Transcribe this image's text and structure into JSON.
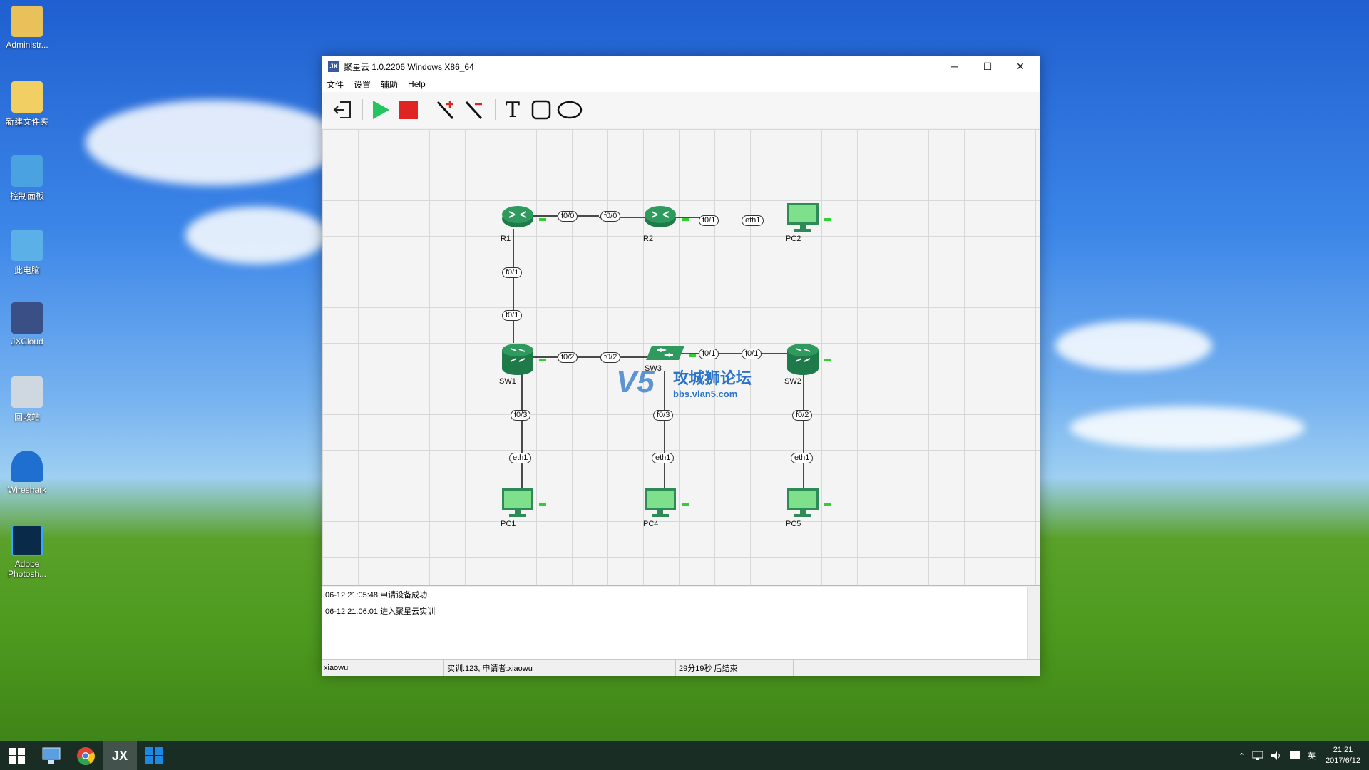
{
  "desktop": {
    "icons": [
      {
        "label": "Administr..."
      },
      {
        "label": "新建文件夹"
      },
      {
        "label": "控制面板"
      },
      {
        "label": "此电脑"
      },
      {
        "label": "JXCloud"
      },
      {
        "label": "回收站"
      },
      {
        "label": "Wireshark"
      },
      {
        "label": "Adobe Photosh..."
      }
    ]
  },
  "window": {
    "title": "聚星云 1.0.2206  Windows  X86_64",
    "app_icon_text": "JX",
    "controls": {
      "minimize": "─",
      "maximize": "☐",
      "close": "✕"
    },
    "menu": [
      "文件",
      "设置",
      "辅助",
      "Help"
    ],
    "toolbar": {
      "text_tool": "T"
    }
  },
  "topology": {
    "nodes": {
      "R1": "R1",
      "R2": "R2",
      "PC2": "PC2",
      "SW1": "SW1",
      "SW3": "SW3",
      "SW2": "SW2",
      "PC1": "PC1",
      "PC4": "PC4",
      "PC5": "PC5"
    },
    "ports": {
      "r1_r2_a": "f0/0",
      "r1_r2_b": "f0/0",
      "r2_pc2_a": "f0/1",
      "r2_pc2_b": "eth1",
      "r1_sw1_a": "f0/1",
      "r1_sw1_b": "f0/1",
      "sw1_sw3_a": "f0/2",
      "sw1_sw3_b": "f0/2",
      "sw3_sw2_a": "f0/1",
      "sw3_sw2_b": "f0/1",
      "sw1_pc1_a": "f0/3",
      "sw1_pc1_b": "eth1",
      "sw3_pc4_a": "f0/3",
      "sw3_pc4_b": "eth1",
      "sw2_pc5_a": "f0/2",
      "sw2_pc5_b": "eth1"
    },
    "watermark": {
      "mark": "V5",
      "title": "攻城狮论坛",
      "url": "bbs.vlan5.com"
    }
  },
  "log": [
    "06-12 21:05:48 申请设备成功",
    "06-12 21:06:01 进入聚星云实训"
  ],
  "statusbar": {
    "user": "xiaowu",
    "session": "实训:123, 申请者:xiaowu",
    "remaining": "29分19秒 后结束"
  },
  "taskbar": {
    "jx_label": "JX",
    "tray_lang": "英",
    "time": "21:21",
    "date": "2017/6/12"
  },
  "colors": {
    "device_green": "#2e8b57",
    "pc_screen": "#7ee08a",
    "led": "#2ed12e",
    "title_bar": "#ffffff"
  }
}
